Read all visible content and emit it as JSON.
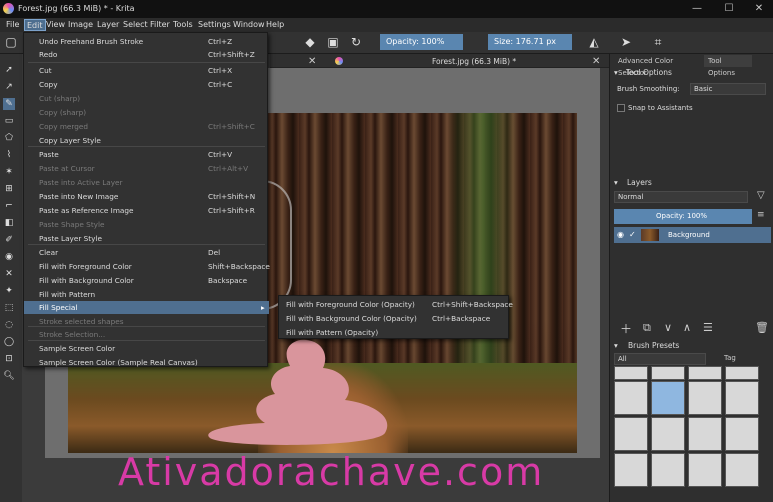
{
  "window": {
    "title": "Forest.jpg (66.3 MiB) * - Krita",
    "controls": [
      "—",
      "☐",
      "✕"
    ]
  },
  "menubar": [
    "File",
    "Edit",
    "View",
    "Image",
    "Layer",
    "Select",
    "Filter",
    "Tools",
    "Settings",
    "Window",
    "Help"
  ],
  "toolbar": {
    "opacity": "Opacity: 100%",
    "size": "Size: 176.71 px"
  },
  "canvas": {
    "tab_title": "Forest.jpg (66.3 MiB) *"
  },
  "edit_menu": {
    "items": [
      {
        "label": "Undo Freehand Brush Stroke",
        "shortcut": "Ctrl+Z",
        "disabled": false
      },
      {
        "label": "Redo",
        "shortcut": "Ctrl+Shift+Z",
        "disabled": false
      },
      {
        "label": "Cut",
        "shortcut": "Ctrl+X",
        "disabled": false
      },
      {
        "label": "Copy",
        "shortcut": "Ctrl+C",
        "disabled": false
      },
      {
        "label": "Cut (sharp)",
        "shortcut": "",
        "disabled": true
      },
      {
        "label": "Copy (sharp)",
        "shortcut": "",
        "disabled": true
      },
      {
        "label": "Copy merged",
        "shortcut": "Ctrl+Shift+C",
        "disabled": true
      },
      {
        "label": "Copy Layer Style",
        "shortcut": "",
        "disabled": false
      },
      {
        "label": "Paste",
        "shortcut": "Ctrl+V",
        "disabled": false
      },
      {
        "label": "Paste at Cursor",
        "shortcut": "Ctrl+Alt+V",
        "disabled": true
      },
      {
        "label": "Paste into Active Layer",
        "shortcut": "",
        "disabled": true
      },
      {
        "label": "Paste into New Image",
        "shortcut": "Ctrl+Shift+N",
        "disabled": false
      },
      {
        "label": "Paste as Reference Image",
        "shortcut": "Ctrl+Shift+R",
        "disabled": false
      },
      {
        "label": "Paste Shape Style",
        "shortcut": "",
        "disabled": true
      },
      {
        "label": "Paste Layer Style",
        "shortcut": "",
        "disabled": false
      },
      {
        "label": "Clear",
        "shortcut": "Del",
        "disabled": false
      },
      {
        "label": "Fill with Foreground Color",
        "shortcut": "Shift+Backspace",
        "disabled": false
      },
      {
        "label": "Fill with Background Color",
        "shortcut": "Backspace",
        "disabled": false
      },
      {
        "label": "Fill with Pattern",
        "shortcut": "",
        "disabled": false
      },
      {
        "label": "Fill Special",
        "shortcut": "",
        "disabled": false
      },
      {
        "label": "Stroke selected shapes",
        "shortcut": "",
        "disabled": true
      },
      {
        "label": "Stroke Selection...",
        "shortcut": "",
        "disabled": true
      },
      {
        "label": "Sample Screen Color",
        "shortcut": "",
        "disabled": false
      },
      {
        "label": "Sample Screen Color (Sample Real Canvas)",
        "shortcut": "",
        "disabled": false
      }
    ]
  },
  "fill_special_submenu": [
    {
      "label": "Fill with Foreground Color (Opacity)",
      "shortcut": "Ctrl+Shift+Backspace"
    },
    {
      "label": "Fill with Background Color (Opacity)",
      "shortcut": "Ctrl+Backspace"
    },
    {
      "label": "Fill with Pattern (Opacity)",
      "shortcut": ""
    }
  ],
  "right_dock": {
    "tabs": [
      "Advanced Color Selector",
      "Tool Options"
    ],
    "tool_options": {
      "title": "Tool Options",
      "smoothing_label": "Brush Smoothing:",
      "smoothing_value": "Basic",
      "snap_label": "Snap to Assistants"
    },
    "layers": {
      "title": "Layers",
      "blend": "Normal",
      "opacity": "Opacity: 100%",
      "layer_name": "Background"
    },
    "brush_presets": {
      "title": "Brush Presets",
      "filter": "All",
      "tag": "Tag"
    }
  },
  "watermark": "Ativadorachave.com",
  "colors": {
    "accent": "#4f6f90",
    "watermark": "#d83aa6",
    "blob": "#d9959c"
  }
}
